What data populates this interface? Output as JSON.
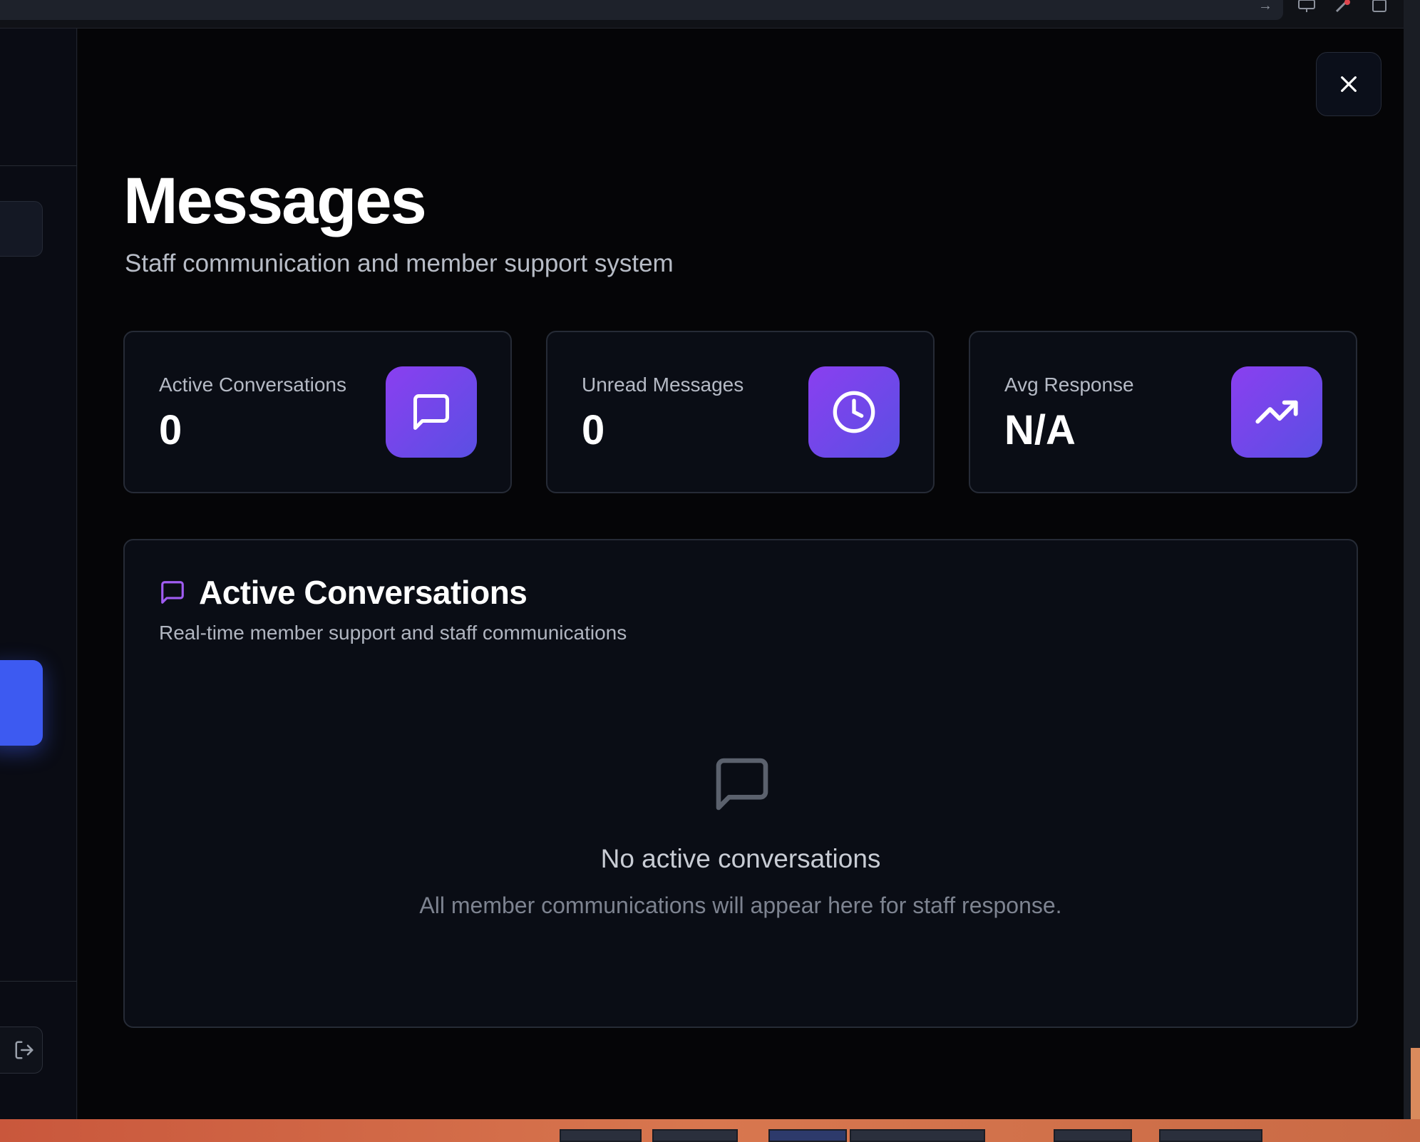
{
  "page": {
    "title": "Messages",
    "subtitle": "Staff communication and member support system"
  },
  "stats": [
    {
      "label": "Active Conversations",
      "value": "0",
      "icon": "message-square-icon"
    },
    {
      "label": "Unread Messages",
      "value": "0",
      "icon": "clock-icon"
    },
    {
      "label": "Avg Response",
      "value": "N/A",
      "icon": "trending-up-icon"
    }
  ],
  "conversations": {
    "heading": "Active Conversations",
    "description": "Real-time member support and staff communications",
    "empty_title": "No active conversations",
    "empty_description": "All member communications will appear here for staff response."
  },
  "colors": {
    "accent_start": "#8a3ff0",
    "accent_end": "#5a4fe3",
    "nav_active": "#3d5af1",
    "background": "#050507",
    "card": "#0a0d15"
  },
  "icons": {
    "close": "close-icon",
    "logout": "logout-icon",
    "section": "message-square-icon",
    "empty": "message-square-icon"
  }
}
